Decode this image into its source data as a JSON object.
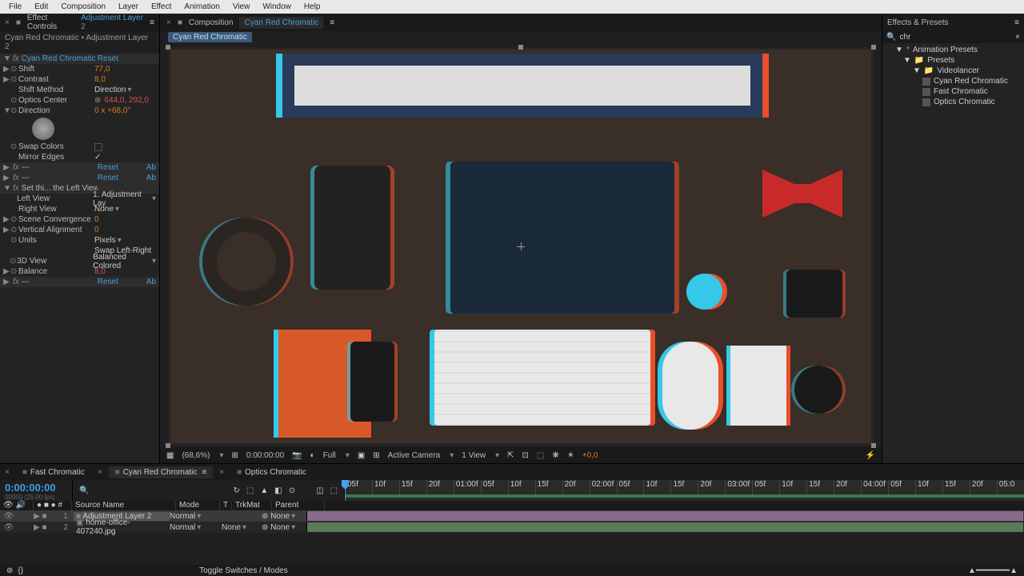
{
  "menu": [
    "File",
    "Edit",
    "Composition",
    "Layer",
    "Effect",
    "Animation",
    "View",
    "Window",
    "Help"
  ],
  "ec": {
    "panel": "Effect Controls",
    "layer": "Adjustment Layer 2",
    "crumb": "Cyan Red Chromatic • Adjustment Layer 2",
    "fx_name": "Cyan Red Chromatic",
    "reset": "Reset",
    "shift": "Shift",
    "shift_v": "77,0",
    "contrast": "Contrast",
    "contrast_v": "8,0",
    "method": "Shift Method",
    "method_v": "Direction",
    "center": "Optics Center",
    "center_v": "644,0, 292,0",
    "direction": "Direction",
    "direction_v": "0 x +68,0°",
    "swap": "Swap Colors",
    "mirror": "Mirror Edges",
    "fx_dash": "---",
    "ab": "Ab",
    "setthis": "Set thi... the Left View",
    "leftview": "Left View",
    "leftview_v": "1. Adjustment Lay",
    "rightview": "Right View",
    "rightview_v": "None",
    "sceneconv": "Scene Convergence",
    "sceneconv_v": "0",
    "valign": "Vertical Alignment",
    "valign_v": "0",
    "units": "Units",
    "units_v": "Pixels",
    "swaplr": "Swap Left-Right",
    "view3d": "3D View",
    "view3d_v": "Balanced Colored",
    "balance": "Balance",
    "balance_v": "8,0"
  },
  "comp": {
    "panel": "Composition",
    "name": "Cyan Red Chromatic",
    "tab": "Cyan Red Chromatic",
    "zoom": "(68,6%)",
    "time": "0:00:00:00",
    "res": "Full",
    "cam": "Active Camera",
    "views": "1 View",
    "exp": "+0,0"
  },
  "ep": {
    "panel": "Effects & Presets",
    "search": "chr",
    "root": "Animation Presets",
    "presets": "Presets",
    "folder": "Videolancer",
    "items": [
      "Cyan Red Chromatic",
      "Fast Chromatic",
      "Optics Chromatic"
    ]
  },
  "tl": {
    "tabs": [
      "Fast Chromatic",
      "Cyan Red Chromatic",
      "Optics Chromatic"
    ],
    "tc": "0:00:00:00",
    "fr": "00000 (25.00 fps)",
    "cols": {
      "source": "Source Name",
      "mode": "Mode",
      "t": "T",
      "trk": "TrkMat",
      "parent": "Parent"
    },
    "layers": [
      {
        "idx": "1",
        "name": "Adjustment Layer 2",
        "mode": "Normal",
        "trk": "",
        "par": "None"
      },
      {
        "idx": "2",
        "name": "home-office-407240.jpg",
        "mode": "Normal",
        "trk": "None",
        "par": "None"
      }
    ],
    "switches": "Toggle Switches / Modes",
    "ruler": [
      "05f",
      "10f",
      "15f",
      "20f",
      "01:00f",
      "05f",
      "10f",
      "15f",
      "20f",
      "02:00f",
      "05f",
      "10f",
      "15f",
      "20f",
      "03:00f",
      "05f",
      "10f",
      "15f",
      "20f",
      "04:00f",
      "05f",
      "10f",
      "15f",
      "20f",
      "05:0"
    ]
  }
}
